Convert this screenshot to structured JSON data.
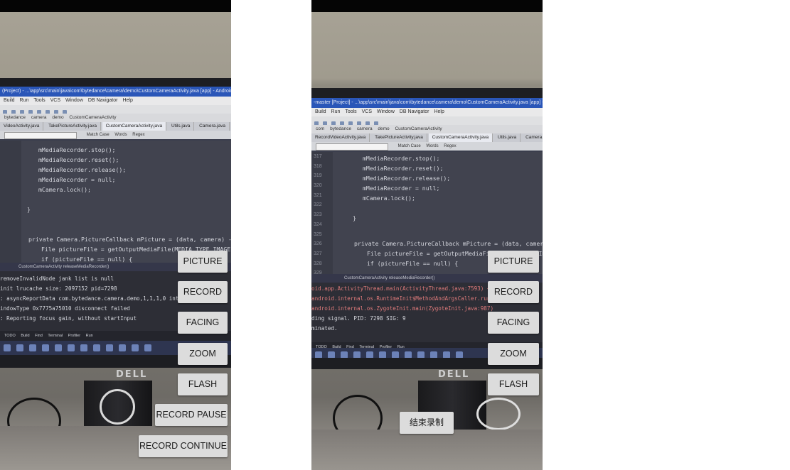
{
  "left_phone": {
    "ide": {
      "title": "(Project) - ...\\app\\src\\main\\java\\com\\bytedance\\camera\\demo\\CustomCameraActivity.java [app] - Android Studio",
      "menu": [
        "Build",
        "Run",
        "Tools",
        "VCS",
        "Window",
        "DB Navigator",
        "Help"
      ],
      "crumbs": [
        "bytedance",
        "camera",
        "demo",
        "CustomCameraActivity"
      ],
      "tabs": [
        "VideoActivity.java",
        "TakePictureActivity.java",
        "CustomCameraActivity.java",
        "Utils.java",
        "Camera.java"
      ],
      "search_opts": [
        "Match Case",
        "Words",
        "Regex"
      ],
      "line_numbers": [],
      "code": [
        "mMediaRecorder.stop();",
        "mMediaRecorder.reset();",
        "mMediaRecorder.release();",
        "mMediaRecorder = null;",
        "mCamera.lock();",
        "}",
        "private Camera.PictureCallback mPicture = (data, camera) -> {",
        "File pictureFile = getOutputMediaFile(MEDIA_TYPE_IMAGE);",
        "if (pictureFile == null) {"
      ],
      "code_footer": [
        "CustomCameraActivity",
        "releaseMediaRecorder()"
      ],
      "console": [
        "removeInvalidNode jank list is null",
        "init lrucache size: 2097152 pid=7298",
        ": asyncReportData com.bytedance.camera.demo,1,1,1,0 interval=588",
        "indowType 0x7775a75010 disconnect failed",
        ": Reporting focus gain, without startInput"
      ],
      "bottom_tabs": [
        "TODO",
        "Build",
        "Find",
        "Terminal",
        "Profiler",
        "Run"
      ],
      "monitor_logo": "DELL"
    },
    "buttons": {
      "picture": "PICTURE",
      "record": "RECORD",
      "facing": "FACING",
      "zoom": "ZOOM",
      "flash": "FLASH",
      "record_pause": "RECORD PAUSE",
      "record_continue": "RECORD CONTINUE"
    }
  },
  "right_phone": {
    "ide": {
      "title": "-master [Project] - ...\\app\\src\\main\\java\\com\\bytedance\\camera\\demo\\CustomCameraActivity.java [app] - Android Studio",
      "menu": [
        "Build",
        "Run",
        "Tools",
        "VCS",
        "Window",
        "DB Navigator",
        "Help"
      ],
      "crumbs": [
        "com",
        "bytedance",
        "camera",
        "demo",
        "CustomCameraActivity"
      ],
      "tabs": [
        "RecordVideoActivity.java",
        "TakePictureActivity.java",
        "CustomCameraActivity.java",
        "Utils.java",
        "Camera.java"
      ],
      "search_opts": [
        "Match Case",
        "Words",
        "Regex"
      ],
      "line_numbers": [
        "317",
        "318",
        "319",
        "320",
        "321",
        "322",
        "323",
        "324",
        "325",
        "326",
        "327",
        "328",
        "329"
      ],
      "code": [
        "mMediaRecorder.stop();",
        "mMediaRecorder.reset();",
        "mMediaRecorder.release();",
        "mMediaRecorder = null;",
        "mCamera.lock();",
        "}",
        "private Camera.PictureCallback mPicture = (data, camera) -> {",
        "File pictureFile = getOutputMediaFile(MEDIA_TYPE_IMAGE);",
        "if (pictureFile == null) {"
      ],
      "code_footer": [
        "CustomCameraActivity",
        "releaseMediaRecorder()"
      ],
      "console": [
        "oid.app.ActivityThread.main(ActivityThread.java:7593) <1 interna",
        "android.internal.os.RuntimeInit$MethodAndArgsCaller.run(RuntimeI",
        "android.internal.os.ZygoteInit.main(ZygoteInit.java:987)",
        "ding signal. PID: 7298 SIG: 9",
        "minated."
      ],
      "bottom_tabs": [
        "TODO",
        "Build",
        "Find",
        "Terminal",
        "Profiler",
        "Run"
      ],
      "monitor_logo": "DELL"
    },
    "buttons": {
      "picture": "PICTURE",
      "record": "RECORD",
      "facing": "FACING",
      "zoom": "ZOOM",
      "flash": "FLASH",
      "stop_recording": "结束录制"
    }
  }
}
